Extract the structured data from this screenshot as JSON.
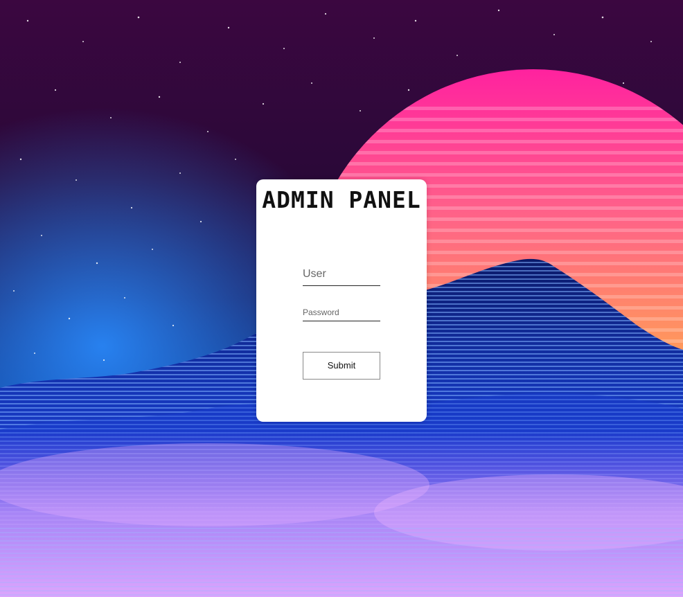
{
  "login": {
    "title": "ADMIN PANEL",
    "user_placeholder": "User",
    "password_placeholder": "Password",
    "submit_label": "Submit"
  },
  "background": {
    "description_icon": "synthwave-mountains-background",
    "colors": {
      "sky_top": "#3b0740",
      "sun_top": "#ff2aa6",
      "sun_bottom": "#ffb238",
      "mountain": "#1e4dff",
      "mist": "#d98cff"
    }
  }
}
